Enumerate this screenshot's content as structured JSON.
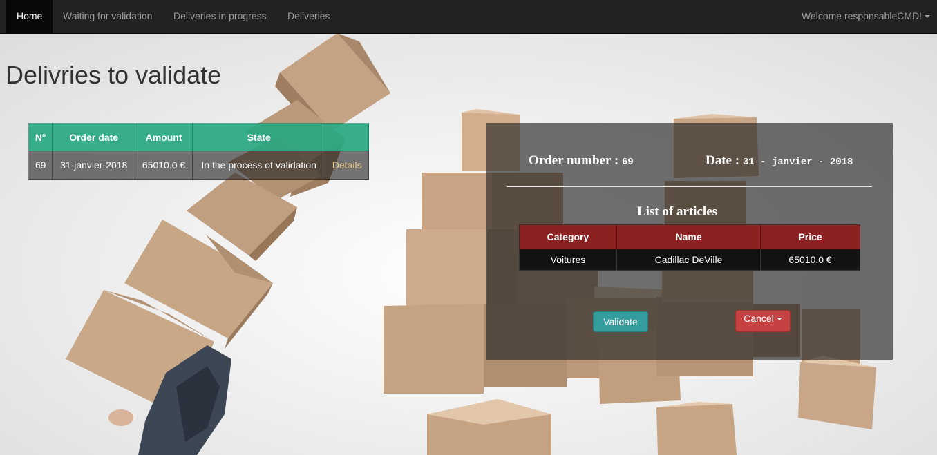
{
  "navbar": {
    "items": [
      {
        "label": "Home",
        "active": true
      },
      {
        "label": "Waiting for validation",
        "active": false
      },
      {
        "label": "Deliveries in progress",
        "active": false
      },
      {
        "label": "Deliveries",
        "active": false
      }
    ],
    "user_label": "Welcome responsableCMD!"
  },
  "page": {
    "title": "Delivries to validate"
  },
  "orders_table": {
    "headers": [
      "N°",
      "Order date",
      "Amount",
      "State",
      ""
    ],
    "rows": [
      {
        "number": "69",
        "date": "31-janvier-2018",
        "amount": "65010.0 €",
        "state": "In the process of validation",
        "link": "Details"
      }
    ]
  },
  "order_details": {
    "order_number_label": "Order number :",
    "order_number": "69",
    "date_label": "Date :",
    "date": "31 - janvier - 2018",
    "articles_title": "List of articles",
    "articles_headers": [
      "Category",
      "Name",
      "Price"
    ],
    "articles": [
      {
        "category": "Voitures",
        "name": "Cadillac DeVille",
        "price": "65010.0 €"
      }
    ],
    "validate_label": "Validate",
    "cancel_label": "Cancel"
  },
  "colors": {
    "navbar_bg": "#222222",
    "orders_header": "#29a882",
    "articles_header": "#8b2121",
    "validate_button": "#359d9e",
    "cancel_button": "#c64242",
    "details_link": "#e8c88a"
  }
}
